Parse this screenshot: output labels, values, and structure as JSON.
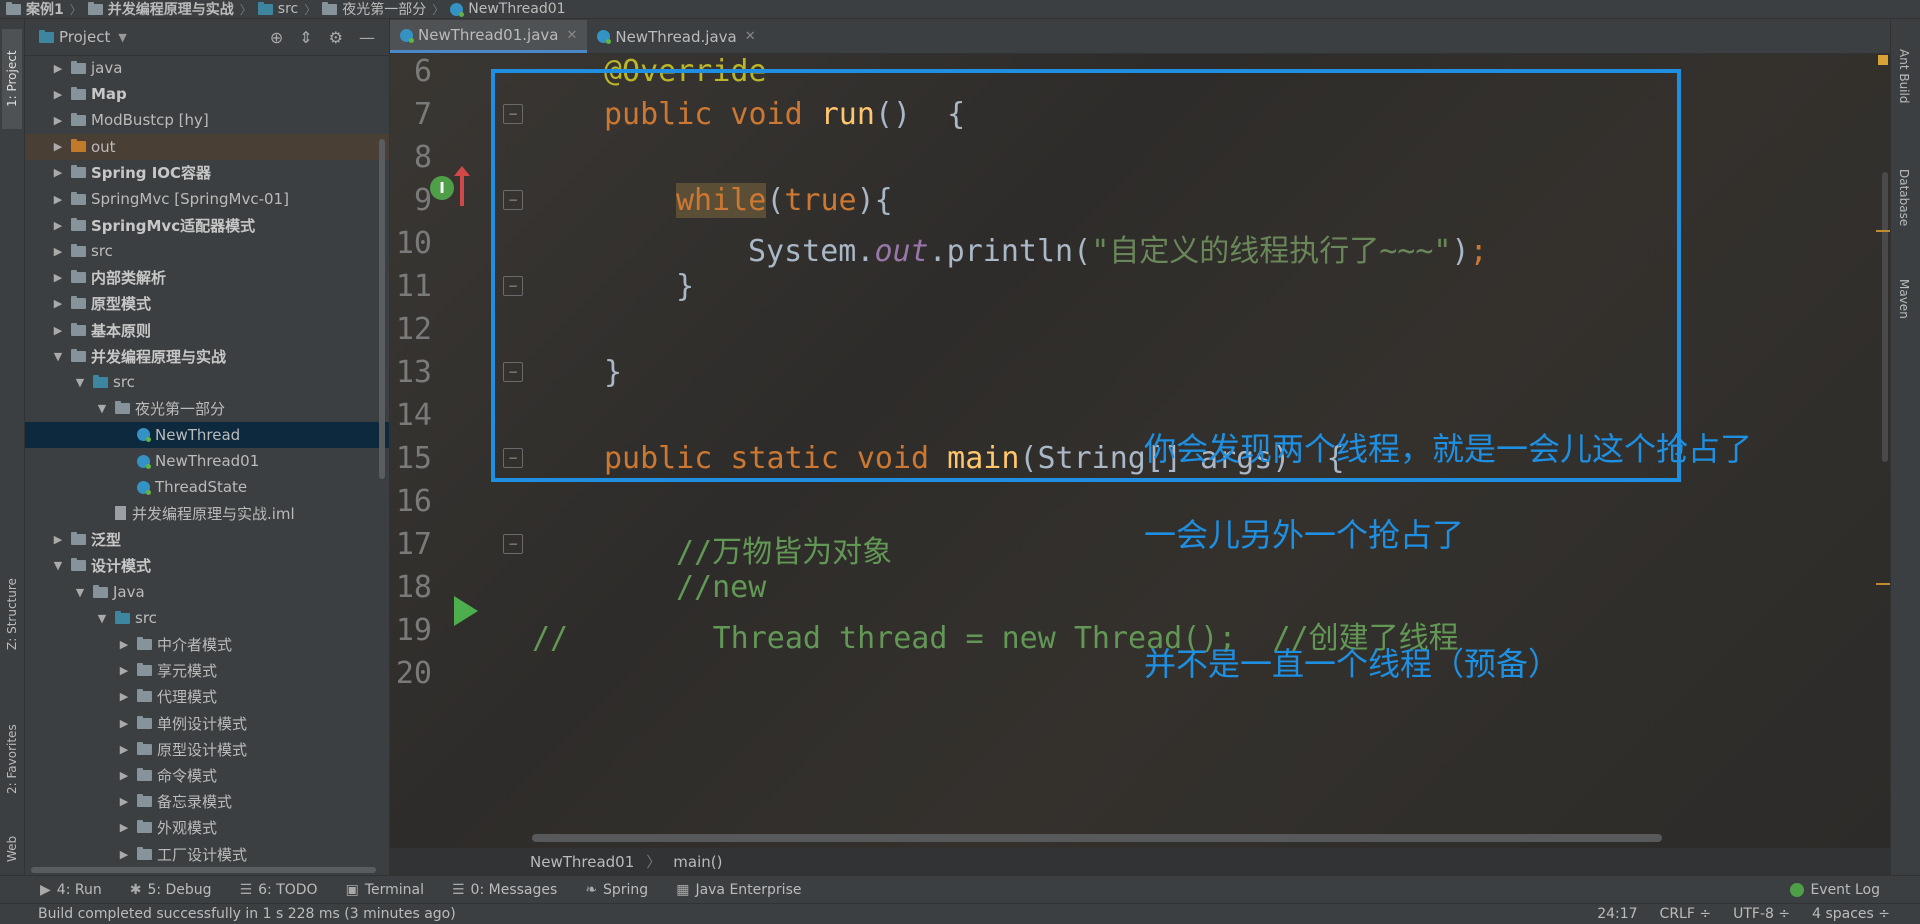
{
  "breadcrumb": [
    "案例1",
    "并发编程原理与实战",
    "src",
    "夜光第一部分",
    "NewThread01"
  ],
  "left_strip": {
    "project": "1: Project",
    "structure": "Z: Structure",
    "favorites": "2: Favorites",
    "web": "Web"
  },
  "project_panel": {
    "title": "Project",
    "rows": [
      {
        "label": "java",
        "indent": 0,
        "arrow": "▶",
        "icon": "folder"
      },
      {
        "label": "Map",
        "indent": 0,
        "arrow": "▶",
        "icon": "folder",
        "bold": true
      },
      {
        "label": "ModBustcp [hy]",
        "indent": 0,
        "arrow": "▶",
        "icon": "folder"
      },
      {
        "label": "out",
        "indent": 0,
        "arrow": "▶",
        "icon": "folder-orange",
        "highlight": true
      },
      {
        "label": "Spring IOC容器",
        "indent": 0,
        "arrow": "▶",
        "icon": "folder",
        "bold": true
      },
      {
        "label": "SpringMvc [SpringMvc-01]",
        "indent": 0,
        "arrow": "▶",
        "icon": "folder"
      },
      {
        "label": "SpringMvc适配器模式",
        "indent": 0,
        "arrow": "▶",
        "icon": "folder",
        "bold": true
      },
      {
        "label": "src",
        "indent": 0,
        "arrow": "▶",
        "icon": "folder"
      },
      {
        "label": "内部类解析",
        "indent": 0,
        "arrow": "▶",
        "icon": "folder",
        "bold": true
      },
      {
        "label": "原型模式",
        "indent": 0,
        "arrow": "▶",
        "icon": "folder",
        "bold": true
      },
      {
        "label": "基本原则",
        "indent": 0,
        "arrow": "▶",
        "icon": "folder",
        "bold": true
      },
      {
        "label": "并发编程原理与实战",
        "indent": 0,
        "arrow": "▼",
        "icon": "folder",
        "bold": true
      },
      {
        "label": "src",
        "indent": 1,
        "arrow": "▼",
        "icon": "folder-blue"
      },
      {
        "label": "夜光第一部分",
        "indent": 2,
        "arrow": "▼",
        "icon": "folder"
      },
      {
        "label": "NewThread",
        "indent": 3,
        "arrow": "",
        "icon": "java",
        "selected": true
      },
      {
        "label": "NewThread01",
        "indent": 3,
        "arrow": "",
        "icon": "java"
      },
      {
        "label": "ThreadState",
        "indent": 3,
        "arrow": "",
        "icon": "java"
      },
      {
        "label": "并发编程原理与实战.iml",
        "indent": 2,
        "arrow": "",
        "icon": "file"
      },
      {
        "label": "泛型",
        "indent": 0,
        "arrow": "▶",
        "icon": "folder",
        "bold": true
      },
      {
        "label": "设计模式",
        "indent": 0,
        "arrow": "▼",
        "icon": "folder",
        "bold": true
      },
      {
        "label": "Java",
        "indent": 1,
        "arrow": "▼",
        "icon": "folder"
      },
      {
        "label": "src",
        "indent": 2,
        "arrow": "▼",
        "icon": "folder-blue"
      },
      {
        "label": "中介者模式",
        "indent": 3,
        "arrow": "▶",
        "icon": "folder"
      },
      {
        "label": "享元模式",
        "indent": 3,
        "arrow": "▶",
        "icon": "folder"
      },
      {
        "label": "代理模式",
        "indent": 3,
        "arrow": "▶",
        "icon": "folder"
      },
      {
        "label": "单例设计模式",
        "indent": 3,
        "arrow": "▶",
        "icon": "folder"
      },
      {
        "label": "原型设计模式",
        "indent": 3,
        "arrow": "▶",
        "icon": "folder"
      },
      {
        "label": "命令模式",
        "indent": 3,
        "arrow": "▶",
        "icon": "folder"
      },
      {
        "label": "备忘录模式",
        "indent": 3,
        "arrow": "▶",
        "icon": "folder"
      },
      {
        "label": "外观模式",
        "indent": 3,
        "arrow": "▶",
        "icon": "folder"
      },
      {
        "label": "工厂设计模式",
        "indent": 3,
        "arrow": "▶",
        "icon": "folder"
      }
    ]
  },
  "tabs": [
    {
      "label": "NewThread01.java",
      "active": true
    },
    {
      "label": "NewThread.java",
      "active": false
    }
  ],
  "editor": {
    "line_numbers": [
      "6",
      "7",
      "8",
      "9",
      "10",
      "11",
      "12",
      "13",
      "14",
      "15",
      "16",
      "17",
      "18",
      "19",
      "20"
    ],
    "notes": [
      "你会发现两个线程，就是一会儿这个抢占了",
      "一会儿另外一个抢占了",
      "并不是一直一个线程（预备）"
    ],
    "code": {
      "l6_ann": "@Override",
      "l7_kw": "public void ",
      "l7_fn": "run",
      "l7_rest": "()  {",
      "l9_kw": "while",
      "l9_rest": "(",
      "l9_kw2": "true",
      "l9_rest2": "){",
      "l10_a": "System.",
      "l10_fld": "out",
      "l10_b": ".println(",
      "l10_str": "\"自定义的线程执行了~~~\"",
      "l10_c": ")",
      "l10_semi": ";",
      "l11": "}",
      "l13": "}",
      "l15_kw": "public static void ",
      "l15_fn": "main",
      "l15_rest": "(String[] args)  {",
      "l17": "//万物皆为对象",
      "l18": "//new",
      "l19": "//        Thread thread = new Thread();  //创建了线程"
    }
  },
  "editor_breadcrumb": [
    "NewThread01",
    "main()"
  ],
  "right_strip": [
    "Ant Build",
    "Database",
    "Maven"
  ],
  "tool_bar": {
    "run": "4: Run",
    "debug": "5: Debug",
    "todo": "6: TODO",
    "terminal": "Terminal",
    "messages": "0: Messages",
    "spring": "Spring",
    "java_enterprise": "Java Enterprise",
    "event_log": "Event Log"
  },
  "status": {
    "message": "Build completed successfully in 1 s 228 ms (3 minutes ago)",
    "position": "24:17",
    "line_sep": "CRLF ÷",
    "encoding": "UTF-8 ÷",
    "indent": "4 spaces ÷"
  }
}
